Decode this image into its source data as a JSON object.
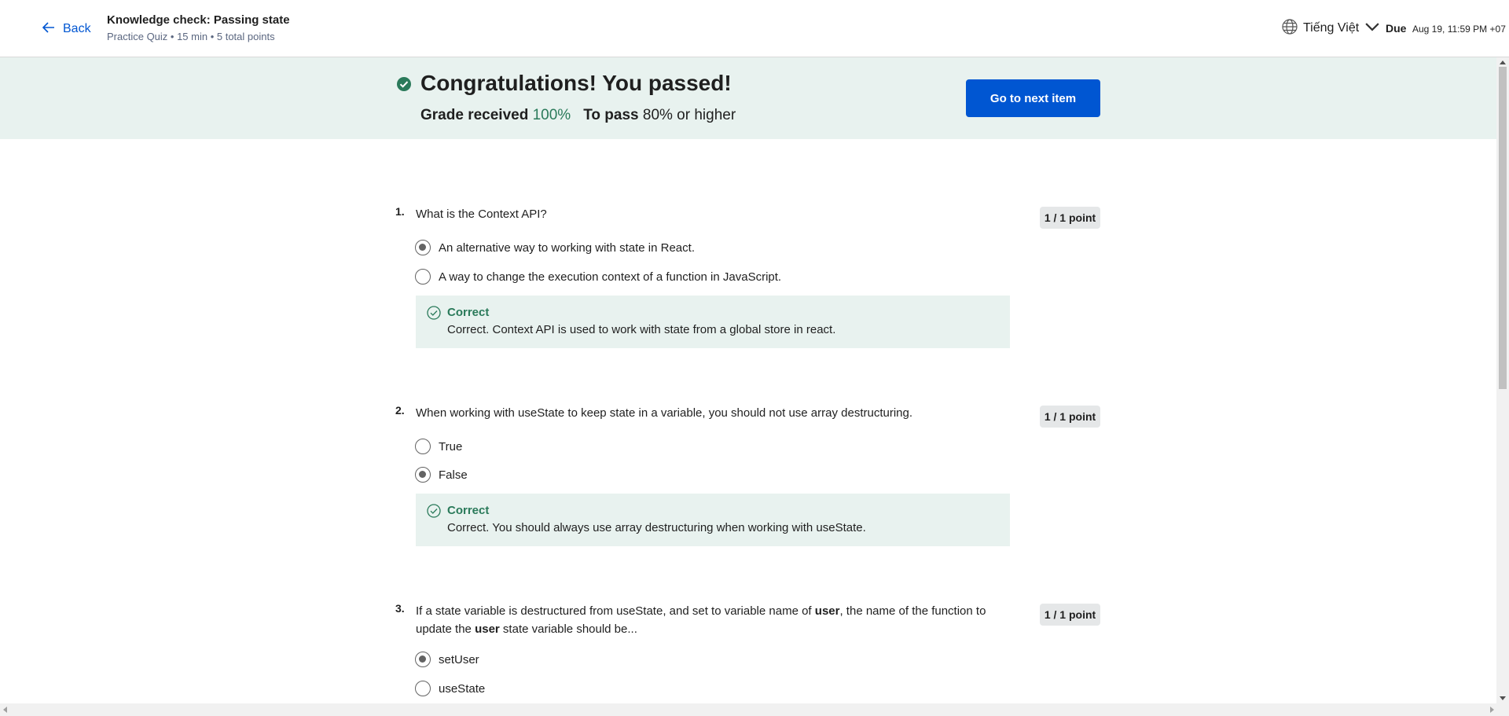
{
  "header": {
    "back_label": "Back",
    "title": "Knowledge check: Passing state",
    "meta": "Practice Quiz • 15 min • 5 total points",
    "language": "Tiếng Việt",
    "due_label": "Due",
    "due_date": "Aug 19, 11:59 PM +07"
  },
  "banner": {
    "title": "Congratulations! You passed!",
    "grade_label": "Grade received",
    "grade_value": "100%",
    "pass_label": "To pass",
    "pass_value": "80% or higher",
    "next_button": "Go to next item"
  },
  "questions": [
    {
      "number": "1.",
      "text": "What is the Context API?",
      "points": "1 / 1 point",
      "options": [
        {
          "label": "An alternative way to working with state in React.",
          "selected": true
        },
        {
          "label": "A way to change the execution context of a function in JavaScript.",
          "selected": false
        }
      ],
      "feedback": {
        "title": "Correct",
        "text": "Correct. Context API is used to work with state from a global store in react."
      }
    },
    {
      "number": "2.",
      "text": "When working with useState to keep state in a variable, you should not use array destructuring.",
      "points": "1 / 1 point",
      "options": [
        {
          "label": "True",
          "selected": false
        },
        {
          "label": "False",
          "selected": true
        }
      ],
      "feedback": {
        "title": "Correct",
        "text": "Correct. You should always use array destructuring when working with useState."
      }
    },
    {
      "number": "3.",
      "text_parts": {
        "a": "If a state variable is destructured from useState, and set to variable name of ",
        "b": "user",
        "c": ", the name of the function to update the ",
        "d": "user",
        "e": " state variable should be..."
      },
      "points": "1 / 1 point",
      "options": [
        {
          "label": "setUser",
          "selected": true
        },
        {
          "label": "useState",
          "selected": false
        }
      ]
    }
  ],
  "colors": {
    "accent": "#0056d2",
    "banner_bg": "#e8f2ef",
    "success": "#2a7a5a"
  },
  "icons": {
    "back": "arrow-left-icon",
    "language": "globe-icon",
    "dropdown": "chevron-down-icon",
    "passed": "check-circle-icon",
    "feedback": "check-circle-outline-icon"
  }
}
